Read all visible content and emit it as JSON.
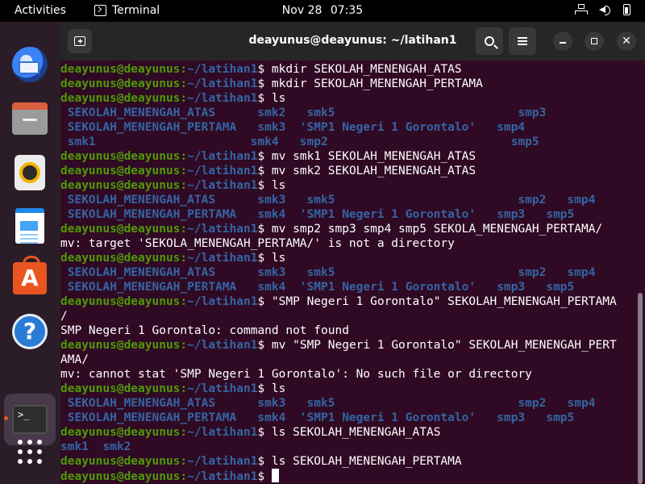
{
  "topbar": {
    "activities": "Activities",
    "app_name": "Terminal",
    "date": "Nov 28",
    "time": "07:35"
  },
  "dock": {
    "items": [
      "thunderbird-icon",
      "files-icon",
      "rhythmbox-icon",
      "writer-icon",
      "software-icon",
      "help-icon",
      "terminal-icon",
      "show-apps-icon"
    ],
    "terminal_glyph": ">_"
  },
  "window": {
    "title": "deayunus@deayunus: ~/latihan1"
  },
  "prompt": {
    "user": "deayunus@deayunus",
    "sep": ":",
    "path": "~/latihan1",
    "dollar": "$ "
  },
  "lines": [
    {
      "type": "cmd",
      "text": "mkdir SEKOLAH_MENENGAH_ATAS"
    },
    {
      "type": "cmd",
      "text": "mkdir SEKOLAH_MENENGAH_PERTAMA"
    },
    {
      "type": "cmd",
      "text": "ls"
    },
    {
      "type": "dir",
      "text": " SEKOLAH_MENENGAH_ATAS      smk2   smk5                          smp3"
    },
    {
      "type": "dir",
      "text": " SEKOLAH_MENENGAH_PERTAMA   smk3  'SMP1 Negeri 1 Gorontalo'   smp4"
    },
    {
      "type": "dir",
      "text": " smk1                      smk4   smp2                          smp5"
    },
    {
      "type": "cmd",
      "text": "mv smk1 SEKOLAH_MENENGAH_ATAS"
    },
    {
      "type": "cmd",
      "text": "mv smk2 SEKOLAH_MENENGAH_ATAS"
    },
    {
      "type": "cmd",
      "text": "ls"
    },
    {
      "type": "dir",
      "text": " SEKOLAH_MENENGAH_ATAS      smk3   smk5                          smp2   smp4"
    },
    {
      "type": "dir",
      "text": " SEKOLAH_MENENGAH_PERTAMA   smk4  'SMP1 Negeri 1 Gorontalo'   smp3   smp5"
    },
    {
      "type": "cmd",
      "text": "mv smp2 smp3 smp4 smp5 SEKOLA_MENENGAH_PERTAMA/"
    },
    {
      "type": "out",
      "text": "mv: target 'SEKOLA_MENENGAH_PERTAMA/' is not a directory"
    },
    {
      "type": "cmd",
      "text": "ls"
    },
    {
      "type": "dir",
      "text": " SEKOLAH_MENENGAH_ATAS      smk3   smk5                          smp2   smp4"
    },
    {
      "type": "dir",
      "text": " SEKOLAH_MENENGAH_PERTAMA   smk4  'SMP1 Negeri 1 Gorontalo'   smp3   smp5"
    },
    {
      "type": "cmd",
      "text": "\"SMP Negeri 1 Gorontalo\" SEKOLAH_MENENGAH_PERTAMA"
    },
    {
      "type": "out",
      "text": "/"
    },
    {
      "type": "out",
      "text": "SMP Negeri 1 Gorontalo: command not found"
    },
    {
      "type": "cmd",
      "text": "mv \"SMP Negeri 1 Gorontalo\" SEKOLAH_MENENGAH_PERT"
    },
    {
      "type": "out",
      "text": "AMA/"
    },
    {
      "type": "out",
      "text": "mv: cannot stat 'SMP Negeri 1 Gorontalo': No such file or directory"
    },
    {
      "type": "cmd",
      "text": "ls"
    },
    {
      "type": "dir",
      "text": " SEKOLAH_MENENGAH_ATAS      smk3   smk5                          smp2   smp4"
    },
    {
      "type": "dir",
      "text": " SEKOLAH_MENENGAH_PERTAMA   smk4  'SMP1 Negeri 1 Gorontalo'   smp3   smp5"
    },
    {
      "type": "cmd",
      "text": "ls SEKOLAH_MENENGAH_ATAS"
    },
    {
      "type": "dir",
      "text": "smk1  smk2"
    },
    {
      "type": "cmd",
      "text": "ls SEKOLAH_MENENGAH_PERTAMA"
    },
    {
      "type": "cursor",
      "text": ""
    }
  ],
  "colors": {
    "terminal_bg": "#300a24",
    "prompt_user": "#4e9a06",
    "prompt_path": "#3465a4",
    "accent": "#e95420"
  }
}
